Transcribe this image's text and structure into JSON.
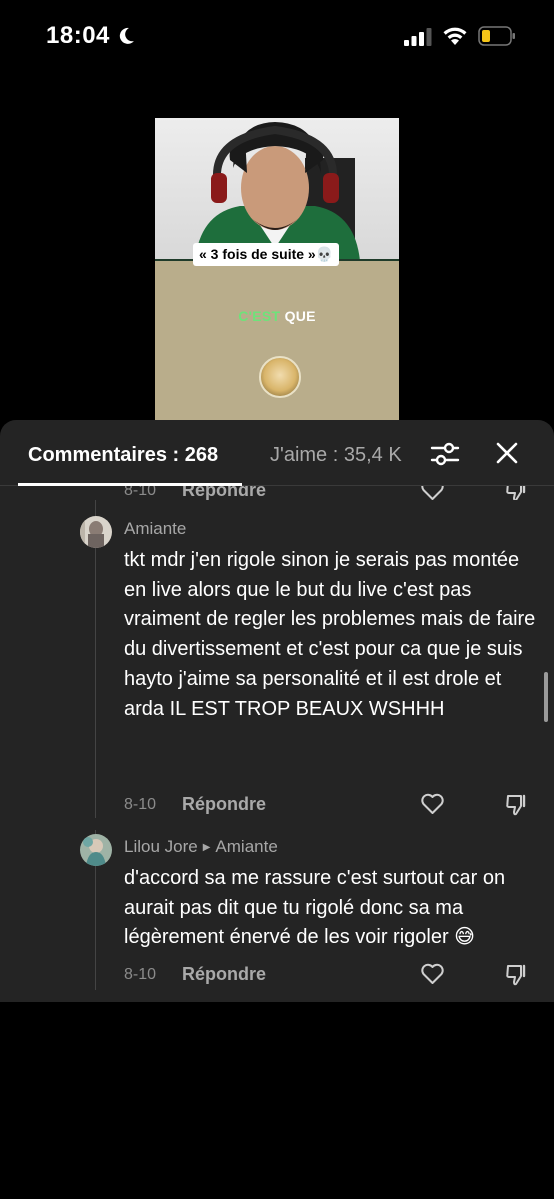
{
  "status_bar": {
    "time": "18:04",
    "icons": [
      "moon-icon",
      "signal-icon",
      "wifi-icon",
      "battery-icon"
    ],
    "battery_color": "#f5c518"
  },
  "video": {
    "caption": "« 3 fois de suite »💀",
    "overlay_green": "C'EST",
    "overlay_white": "QUE"
  },
  "tabs": {
    "comments_label": "Commentaires : 268",
    "likes_label": "J'aime : 35,4 K"
  },
  "comments": [
    {
      "username": "Amiante",
      "text": "tkt mdr j'en rigole sinon je serais pas montée en live alors que le but du live c'est pas vraiment de regler les problemes mais de faire du divertissement et c'est pour ca que je suis hayto j'aime sa personalité et il est drole et arda IL EST TROP BEAUX WSHHH",
      "date": "8-10",
      "reply_label": "Répondre"
    },
    {
      "username": "Lilou Jore",
      "reply_to": "Amiante",
      "text": "d'accord sa me rassure c'est surtout car on aurait pas dit que tu rigolé donc sa ma légèrement énervé de les voir rigoler 😅",
      "date": "8-10",
      "reply_label": "Répondre"
    }
  ],
  "partial_row": {
    "date": "8-10",
    "reply_label": "Répondre"
  }
}
